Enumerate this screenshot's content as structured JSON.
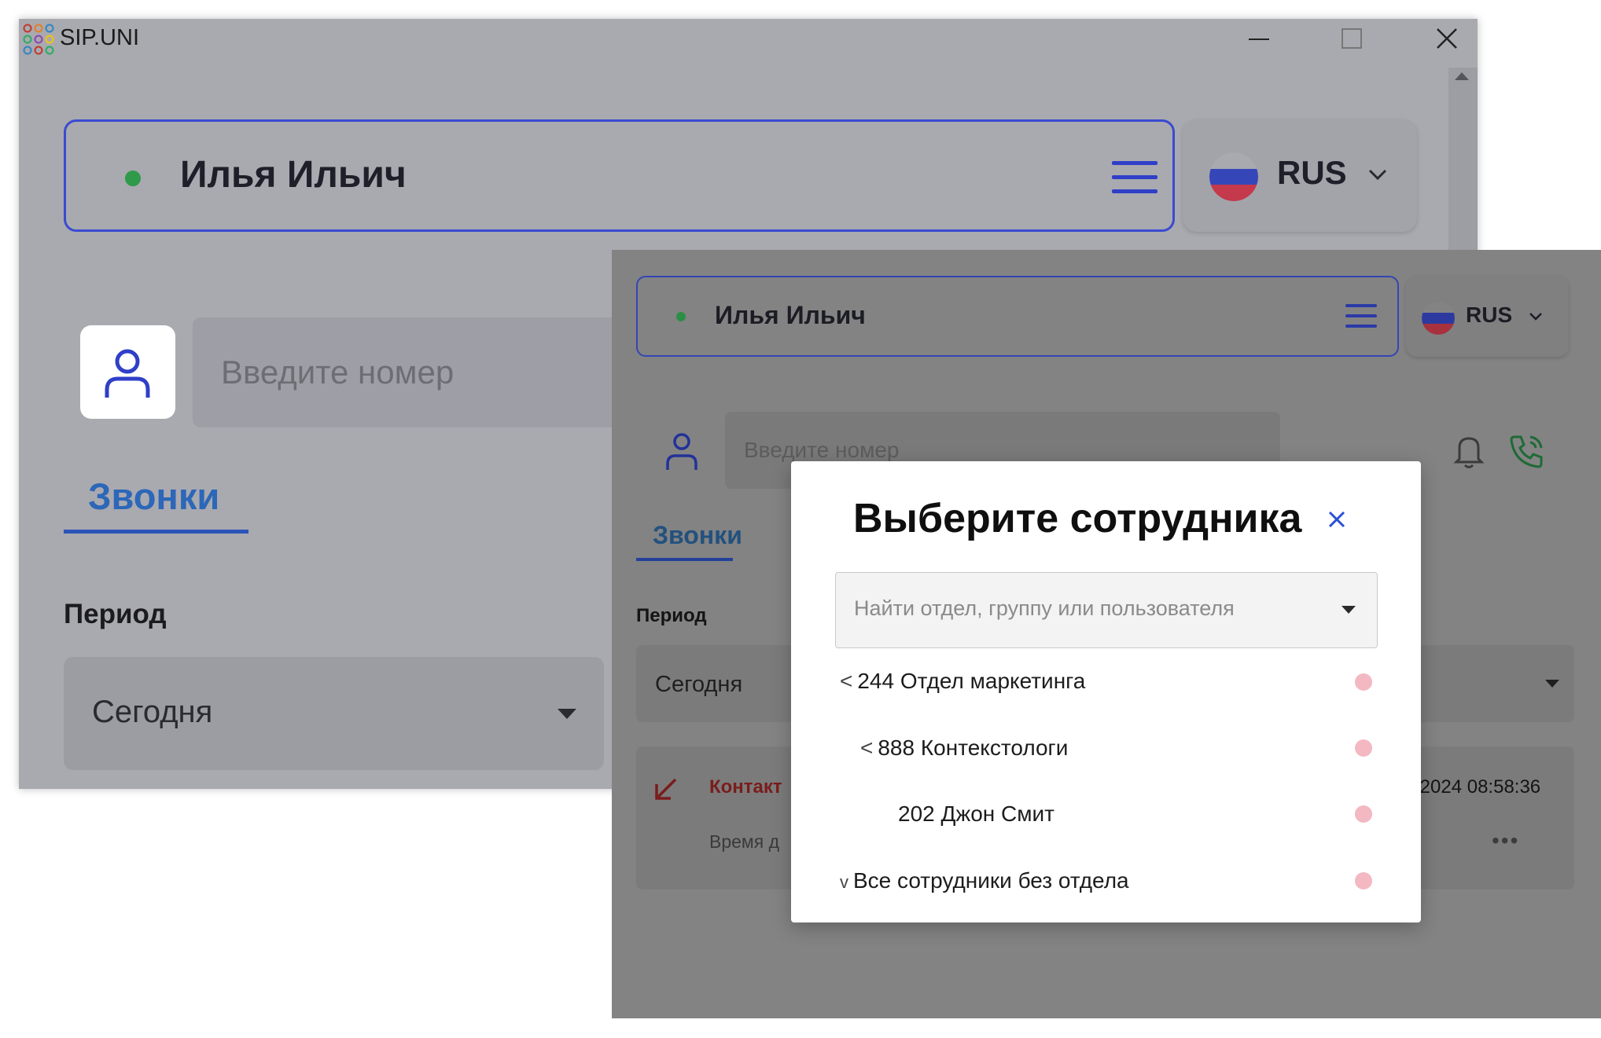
{
  "back_window": {
    "app_title": "SIP.UNI",
    "user": {
      "name": "Илья Ильич",
      "status": "online",
      "status_color": "#2e9a4a"
    },
    "language": {
      "code": "RUS"
    },
    "search": {
      "placeholder": "Введите номер"
    },
    "tabs": [
      {
        "label": "Звонки",
        "active": true
      }
    ],
    "period": {
      "label": "Период",
      "value": "Сегодня"
    }
  },
  "front_window": {
    "user": {
      "name": "Илья Ильич",
      "status": "online"
    },
    "language": {
      "code": "RUS"
    },
    "search": {
      "placeholder": "Введите номер"
    },
    "tabs": [
      {
        "label": "Звонки",
        "active": true
      }
    ],
    "period": {
      "label": "Период",
      "value": "Сегодня"
    },
    "call": {
      "type": "missed",
      "contact": "Контакт",
      "time_label": "Время д",
      "datetime": ".2024 08:58:36"
    }
  },
  "modal": {
    "title": "Выберите сотрудника",
    "search_placeholder": "Найти отдел, группу или пользователя",
    "tree": [
      {
        "chevron": "<",
        "label": "244 Отдел маркетинга",
        "level": 0
      },
      {
        "chevron": "<",
        "label": "888 Контекстологи",
        "level": 1
      },
      {
        "chevron": "",
        "label": "202 Джон Смит",
        "level": 2
      },
      {
        "chevron": "v",
        "label": "Все сотрудники без отдела",
        "level": 0
      }
    ],
    "status_dot_color": "#f3b8c2"
  },
  "colors": {
    "accent_blue": "#2c54b8",
    "missed_red": "#c0392b"
  }
}
